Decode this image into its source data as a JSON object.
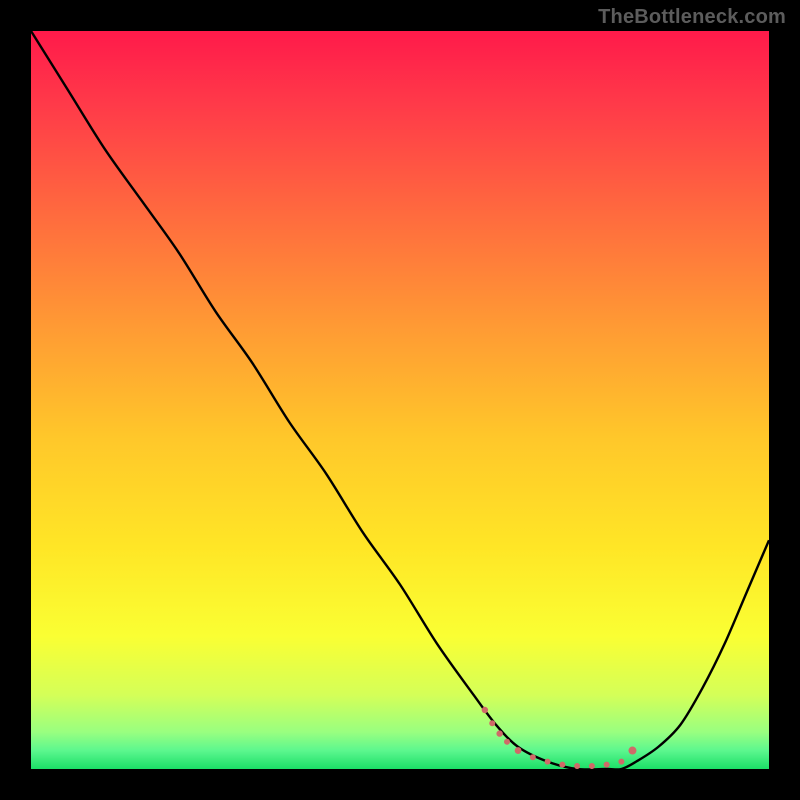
{
  "watermark": "TheBottleneck.com",
  "chart_data": {
    "type": "line",
    "title": "",
    "xlabel": "",
    "ylabel": "",
    "xlim": [
      0,
      100
    ],
    "ylim": [
      0,
      100
    ],
    "grid": false,
    "legend": false,
    "series": [
      {
        "name": "curve",
        "x": [
          0,
          5,
          10,
          15,
          20,
          25,
          30,
          35,
          40,
          45,
          50,
          55,
          60,
          63,
          66,
          70,
          74,
          78,
          80,
          82,
          85,
          88,
          91,
          94,
          97,
          100
        ],
        "y": [
          100,
          92,
          84,
          77,
          70,
          62,
          55,
          47,
          40,
          32,
          25,
          17,
          10,
          6,
          3,
          1,
          0,
          0,
          0,
          1,
          3,
          6,
          11,
          17,
          24,
          31
        ],
        "color": "#000000"
      }
    ],
    "markers": [
      {
        "x": 61.5,
        "y": 8,
        "r": 3.2,
        "color": "#cf6a68"
      },
      {
        "x": 62.5,
        "y": 6.2,
        "r": 3.0,
        "color": "#cf6a68"
      },
      {
        "x": 63.5,
        "y": 4.8,
        "r": 3.2,
        "color": "#cf6a68"
      },
      {
        "x": 64.5,
        "y": 3.7,
        "r": 3.0,
        "color": "#cf6a68"
      },
      {
        "x": 66.0,
        "y": 2.5,
        "r": 3.4,
        "color": "#cf6a68"
      },
      {
        "x": 68.0,
        "y": 1.6,
        "r": 3.0,
        "color": "#cf6a68"
      },
      {
        "x": 70.0,
        "y": 1.0,
        "r": 3.0,
        "color": "#cf6a68"
      },
      {
        "x": 72.0,
        "y": 0.6,
        "r": 3.0,
        "color": "#cf6a68"
      },
      {
        "x": 74.0,
        "y": 0.4,
        "r": 3.0,
        "color": "#cf6a68"
      },
      {
        "x": 76.0,
        "y": 0.4,
        "r": 3.0,
        "color": "#cf6a68"
      },
      {
        "x": 78.0,
        "y": 0.6,
        "r": 3.0,
        "color": "#cf6a68"
      },
      {
        "x": 80.0,
        "y": 1.0,
        "r": 3.0,
        "color": "#cf6a68"
      },
      {
        "x": 81.5,
        "y": 2.5,
        "r": 4.0,
        "color": "#cf6a68"
      }
    ],
    "background_gradient": {
      "type": "vertical",
      "stops": [
        {
          "pos": 0.0,
          "color": "#ff1a4a"
        },
        {
          "pos": 0.1,
          "color": "#ff3a49"
        },
        {
          "pos": 0.25,
          "color": "#ff6b3e"
        },
        {
          "pos": 0.4,
          "color": "#ff9a34"
        },
        {
          "pos": 0.55,
          "color": "#ffc72a"
        },
        {
          "pos": 0.7,
          "color": "#ffe626"
        },
        {
          "pos": 0.82,
          "color": "#faff33"
        },
        {
          "pos": 0.9,
          "color": "#d4ff58"
        },
        {
          "pos": 0.95,
          "color": "#99ff80"
        },
        {
          "pos": 0.975,
          "color": "#5cf78e"
        },
        {
          "pos": 1.0,
          "color": "#1bdf67"
        }
      ]
    }
  }
}
